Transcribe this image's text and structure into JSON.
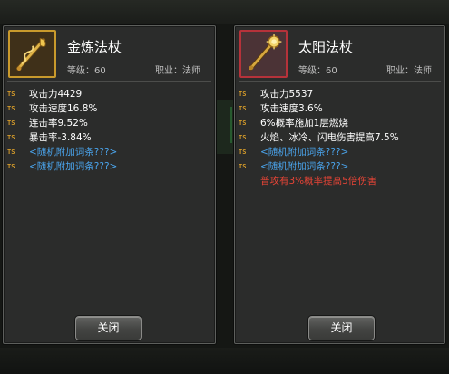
{
  "left_card": {
    "name": "金炼法杖",
    "level": "等级：60",
    "class": "职业：法师",
    "attributes": [
      {
        "tag": "TS",
        "text": "攻击力4429",
        "kind": "normal"
      },
      {
        "tag": "TS",
        "text": "攻击速度16.8%",
        "kind": "normal"
      },
      {
        "tag": "TS",
        "text": "连击率9.52%",
        "kind": "normal"
      },
      {
        "tag": "TS",
        "text": "暴击率-3.84%",
        "kind": "normal"
      },
      {
        "tag": "TS",
        "text": "<随机附加词条???>",
        "kind": "random"
      },
      {
        "tag": "TS",
        "text": "<随机附加词条???>",
        "kind": "random"
      }
    ],
    "close_label": "关闭",
    "icon": "golden-staff-icon",
    "frame_color": "#c99a2c"
  },
  "right_card": {
    "name": "太阳法杖",
    "level": "等级：60",
    "class": "职业：法师",
    "attributes": [
      {
        "tag": "TS",
        "text": "攻击力5537",
        "kind": "normal"
      },
      {
        "tag": "TS",
        "text": "攻击速度3.6%",
        "kind": "normal"
      },
      {
        "tag": "TS",
        "text": "6%概率施加1层燃烧",
        "kind": "normal"
      },
      {
        "tag": "TS",
        "text": "火焰、冰冷、闪电伤害提高7.5%",
        "kind": "normal"
      },
      {
        "tag": "TS",
        "text": "<随机附加词条???>",
        "kind": "random"
      },
      {
        "tag": "TS",
        "text": "<随机附加词条???>",
        "kind": "random"
      }
    ],
    "note": "普攻有3%概率提高5倍伤害",
    "close_label": "关闭",
    "icon": "sun-staff-icon",
    "frame_color": "#b6323a"
  },
  "colors": {
    "panel_bg": "#2b2c2b",
    "tag": "#d39a2a",
    "stat_text": "#ffffff",
    "random_affix": "#4aa3ea",
    "special_note": "#e64436"
  }
}
